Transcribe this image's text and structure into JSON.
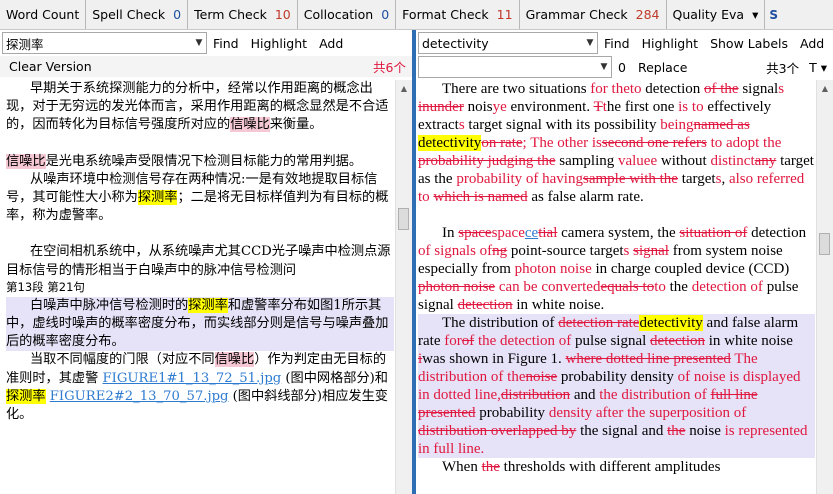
{
  "toolbar": {
    "items": [
      {
        "label": "Word Count",
        "count": ""
      },
      {
        "label": "Spell Check",
        "count": "0"
      },
      {
        "label": "Term Check",
        "count": "10"
      },
      {
        "label": "Collocation",
        "count": "0"
      },
      {
        "label": "Format Check",
        "count": "11"
      },
      {
        "label": "Grammar Check",
        "count": "284"
      },
      {
        "label": "Quality Eva",
        "count": ""
      }
    ],
    "overflow_label": "S"
  },
  "left": {
    "search_value": "探测率",
    "find": "Find",
    "highlight": "Highlight",
    "add": "Add",
    "clear_version": "Clear Version",
    "match_count": "共6个",
    "p1": [
      {
        "t": "早期关于系统探测能力的分析中，经常以作用距离的概念出现，对于无穷远的发光体而言，采用作用距离的概念显然是不合适的，因而转化为目标信号强度所对应的"
      },
      {
        "t": "信噪比",
        "c": "pink"
      },
      {
        "t": "来衡量。"
      }
    ],
    "p2": [
      {
        "t": "信噪比",
        "c": "pink"
      },
      {
        "t": "是光电系统噪声受限情况下检测目标能力的常用判据。"
      }
    ],
    "p3": [
      {
        "t": "从噪声环境中检测信号存在两种情况:一是有效地提取目标信号，其可能性大小称为"
      },
      {
        "t": "探测率",
        "c": "yel"
      },
      {
        "t": "；二是将无目标样值判为有目标的概率，称为虚警率。"
      }
    ],
    "p4": [
      {
        "t": "在空间相机系统中，从系统噪声尤其CCD光子噪声中检测点源目标信号的情形相当于白噪声中的脉冲信号检测问"
      }
    ],
    "marker": "第13段  第21句",
    "p5": [
      {
        "t": "白噪声中脉冲信号检测时的"
      },
      {
        "t": "探测率",
        "c": "yel"
      },
      {
        "t": "和虚警率分布如图1所示其中，虚线时噪声的概率密度分布，而实线部分则是信号与噪声叠加后的概率密度分布。"
      }
    ],
    "p6": [
      {
        "t": "当取不同幅度的门限（对应不同"
      },
      {
        "t": "信噪比",
        "c": "pink"
      },
      {
        "t": "）作为判定由无目标的准则时，其虚警 "
      },
      {
        "t": "FIGURE1#1_13_72_51.jpg",
        "c": "lnk"
      },
      {
        "t": " (图中网格部分)和"
      },
      {
        "t": "探测率",
        "c": "yel"
      },
      {
        "t": " "
      },
      {
        "t": "FIGURE2#2_13_70_57.jpg",
        "c": "lnk"
      },
      {
        "t": " (图中斜线部分)相应发生变化。"
      }
    ]
  },
  "right": {
    "search_value": "detectivity",
    "find": "Find",
    "highlight": "Highlight",
    "show_labels": "Show Labels",
    "add": "Add",
    "replace_count": "0",
    "replace": "Replace",
    "total": "共3个",
    "t_label": "T",
    "p1": [
      {
        "t": "There are two situations "
      },
      {
        "t": "for theto",
        "c": "ins"
      },
      {
        "t": " detection "
      },
      {
        "t": "of the",
        "c": "del"
      },
      {
        "t": " signal"
      },
      {
        "t": "s",
        "c": "ins"
      },
      {
        "t": " "
      },
      {
        "t": "inunder",
        "c": "del"
      },
      {
        "t": " nois"
      },
      {
        "t": "ye",
        "c": "ins"
      },
      {
        "t": " environment. "
      },
      {
        "t": "T",
        "c": "del"
      },
      {
        "t": "t",
        "c": "ins"
      },
      {
        "t": "he first one "
      },
      {
        "t": "is to",
        "c": "ins"
      },
      {
        "t": " effectively extract"
      },
      {
        "t": "s",
        "c": "ins"
      },
      {
        "t": " target signal with its possibility "
      },
      {
        "t": "being",
        "c": "ins"
      },
      {
        "t": "named as",
        "c": "del"
      },
      {
        "t": " "
      },
      {
        "t": "detectivity",
        "c": "yel"
      },
      {
        "t": "on rate",
        "c": "del"
      },
      {
        "t": "; ",
        "c": "ins"
      },
      {
        "t": "T",
        "c": "ins"
      },
      {
        "t": "he other is",
        "c": "ins"
      },
      {
        "t": "second one refers",
        "c": "del"
      },
      {
        "t": " to ",
        "c": "ins"
      },
      {
        "t": "adopt the ",
        "c": "ins"
      },
      {
        "t": "probability judging the",
        "c": "del"
      },
      {
        "t": " sampling "
      },
      {
        "t": "valuee",
        "c": "ins"
      },
      {
        "t": " without "
      },
      {
        "t": "distinct",
        "c": "ins"
      },
      {
        "t": "any",
        "c": "del"
      },
      {
        "t": " target as the "
      },
      {
        "t": "probability of having",
        "c": "ins"
      },
      {
        "t": "sample with the",
        "c": "del"
      },
      {
        "t": " target"
      },
      {
        "t": "s",
        "c": "ins"
      },
      {
        "t": ", "
      },
      {
        "t": "also referred to",
        "c": "ins"
      },
      {
        "t": " "
      },
      {
        "t": "which is named",
        "c": "del"
      },
      {
        "t": " as false alarm rate."
      }
    ],
    "p2": [
      {
        "t": "In "
      },
      {
        "t": "space",
        "c": "del"
      },
      {
        "t": "space",
        "c": "ins"
      },
      {
        "t": "ce",
        "c": "lnk"
      },
      {
        "t": "tial",
        "c": "del"
      },
      {
        "t": " camera system, the "
      },
      {
        "t": "situation of",
        "c": "del"
      },
      {
        "t": " detection "
      },
      {
        "t": "of signals of",
        "c": "ins"
      },
      {
        "t": "ng",
        "c": "del"
      },
      {
        "t": " point-source target"
      },
      {
        "t": "s",
        "c": "ins"
      },
      {
        "t": " "
      },
      {
        "t": "signal",
        "c": "del"
      },
      {
        "t": " from system noise especially from "
      },
      {
        "t": "photon noise",
        "c": "ins"
      },
      {
        "t": " in charge coupled device (CCD) "
      },
      {
        "t": "photon noise",
        "c": "del"
      },
      {
        "t": " "
      },
      {
        "t": "can be converted",
        "c": "ins"
      },
      {
        "t": "equals to",
        "c": "del"
      },
      {
        "t": "to",
        "c": "ins"
      },
      {
        "t": " the "
      },
      {
        "t": "detection of",
        "c": "ins"
      },
      {
        "t": " pulse signal "
      },
      {
        "t": "detection",
        "c": "del"
      },
      {
        "t": " in white noise."
      }
    ],
    "p3": [
      {
        "t": "The distribution of "
      },
      {
        "t": "detection rate",
        "c": "del"
      },
      {
        "t": "detectivity",
        "c": "yel"
      },
      {
        "t": " and false alarm rate "
      },
      {
        "t": "for",
        "c": "ins"
      },
      {
        "t": "of",
        "c": "del"
      },
      {
        "t": " "
      },
      {
        "t": "the detection of",
        "c": "ins"
      },
      {
        "t": " pulse signal "
      },
      {
        "t": "detection",
        "c": "del"
      },
      {
        "t": " in white noise "
      },
      {
        "t": "i",
        "c": "del"
      },
      {
        "t": "was shown in Figure 1. "
      },
      {
        "t": "where dotted line presented",
        "c": "del"
      },
      {
        "t": " "
      },
      {
        "t": "The distribution of the",
        "c": "ins"
      },
      {
        "t": "noise",
        "c": "del"
      },
      {
        "t": " probability density "
      },
      {
        "t": "of noise is displayed in dotted line,",
        "c": "ins"
      },
      {
        "t": "distribution",
        "c": "del"
      },
      {
        "t": " and "
      },
      {
        "t": "the distribution of",
        "c": "ins"
      },
      {
        "t": " "
      },
      {
        "t": "full line presented",
        "c": "del"
      },
      {
        "t": " probability "
      },
      {
        "t": "density after the superposition of",
        "c": "ins"
      },
      {
        "t": " "
      },
      {
        "t": "distribution overlapped by",
        "c": "del"
      },
      {
        "t": " the signal and "
      },
      {
        "t": "the",
        "c": "del"
      },
      {
        "t": " noise "
      },
      {
        "t": "is represented in full line.",
        "c": "ins"
      }
    ],
    "p4": [
      {
        "t": "When "
      },
      {
        "t": "the",
        "c": "del"
      },
      {
        "t": " thresholds with different amplitudes"
      }
    ]
  },
  "colors": {
    "accent": "#2e6eb5",
    "highlight_yellow": "#ffff00",
    "highlight_pink": "#f6c8d4",
    "revision_red": "#e0183f",
    "link_blue": "#2e7bd0"
  }
}
